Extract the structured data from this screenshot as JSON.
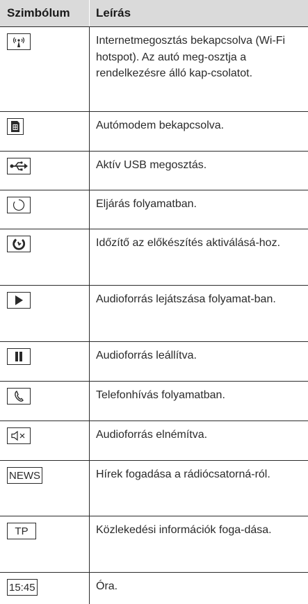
{
  "header": {
    "col_symbol": "Szimbólum",
    "col_description": "Leírás"
  },
  "rows": [
    {
      "icon": "wifi-hotspot-icon",
      "text": "Internetmegosztás bekapcsolva (Wi-Fi hotspot). Az autó meg-osztja a rendelkezésre álló kap-csolatot."
    },
    {
      "icon": "car-modem-sim-icon",
      "text": "Autómodem bekapcsolva."
    },
    {
      "icon": "usb-icon",
      "text": "Aktív USB megosztás."
    },
    {
      "icon": "progress-circle-icon",
      "text": "Eljárás folyamatban."
    },
    {
      "icon": "timer-icon",
      "text": "Időzítő az előkészítés aktiválásá-hoz."
    },
    {
      "icon": "play-icon",
      "text": "Audioforrás lejátszása folyamat-ban."
    },
    {
      "icon": "pause-icon",
      "text": "Audioforrás leállítva."
    },
    {
      "icon": "phone-call-icon",
      "text": "Telefonhívás folyamatban."
    },
    {
      "icon": "speaker-muted-icon",
      "text": "Audioforrás elnémítva."
    },
    {
      "icon": "news-icon",
      "icon_label": "NEWS",
      "text": "Hírek fogadása a rádiócsatorná-ról."
    },
    {
      "icon": "tp-icon",
      "icon_label": "TP",
      "text": "Közlekedési információk foga-dása."
    },
    {
      "icon": "clock-time-icon",
      "icon_label": "15:45",
      "text": "Óra."
    }
  ]
}
